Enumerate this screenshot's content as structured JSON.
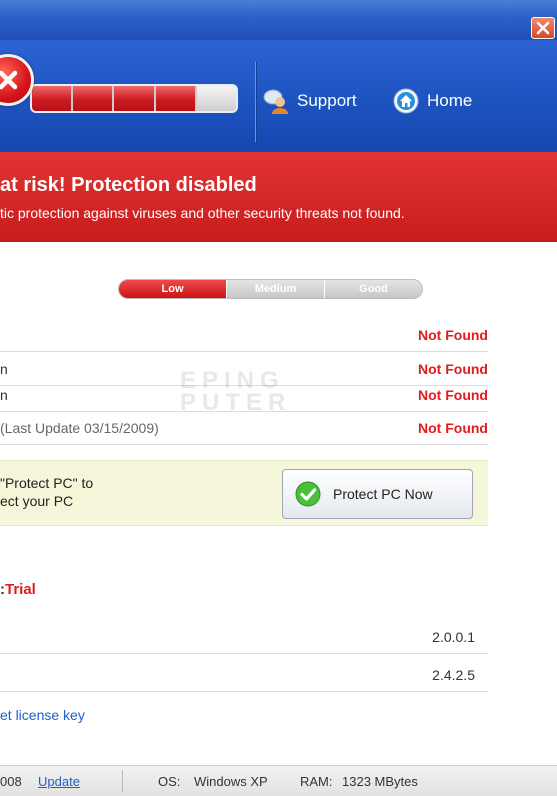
{
  "window": {
    "close_label": "Close"
  },
  "header": {
    "protection_segments": [
      "on",
      "on",
      "on",
      "on",
      "off"
    ],
    "support_label": "Support",
    "home_label": "Home"
  },
  "alert": {
    "title": "at risk! Protection disabled",
    "subtitle": "tic protection against viruses and other security threats not found."
  },
  "protection_level": {
    "levels": [
      "Low",
      "Medium",
      "Good"
    ],
    "current": "Low"
  },
  "status_rows": [
    {
      "label": "",
      "value": "Not Found"
    },
    {
      "label": "n",
      "value": "Not Found"
    },
    {
      "label": "n",
      "value": "Not Found"
    },
    {
      "label": "(Last Update 03/15/2009)",
      "value": "Not Found"
    }
  ],
  "watermark": "EPING\nPUTER",
  "protect": {
    "line1": "\"Protect PC\" to",
    "line2": "ect your PC",
    "button_label": "Protect PC Now"
  },
  "license": {
    "prefix": ":",
    "status": "Trial",
    "versions": [
      "2.0.0.1",
      "2.4.2.5"
    ],
    "get_key_label": "et license key"
  },
  "footer": {
    "date_fragment": "008",
    "update_label": "Update",
    "os_label": "OS:",
    "os_value": "Windows XP",
    "ram_label": "RAM:",
    "ram_value": "1323 MBytes"
  },
  "colors": {
    "accent_red": "#e31b1b",
    "header_blue": "#1f55c2",
    "link_blue": "#1f5fc4"
  }
}
